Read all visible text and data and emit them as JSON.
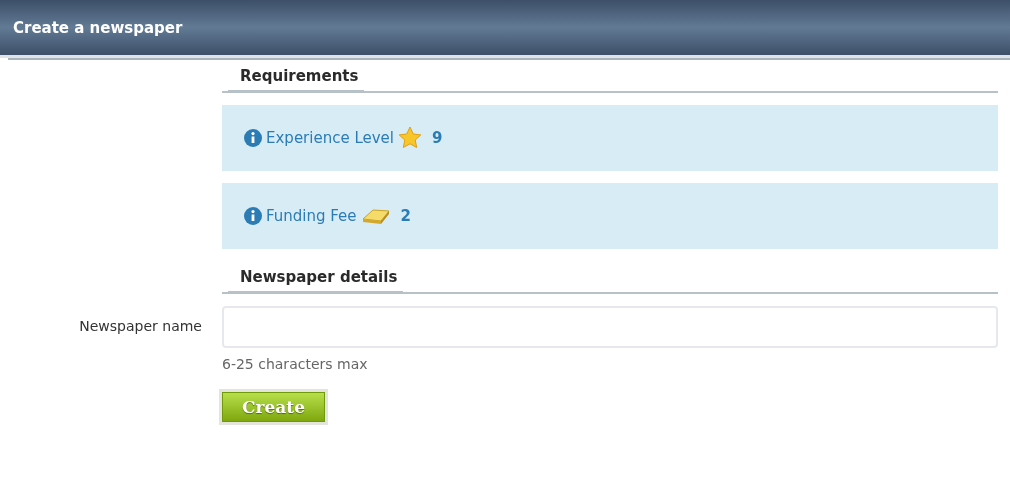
{
  "window": {
    "title": "Create a newspaper"
  },
  "requirements": {
    "heading": "Requirements",
    "items": [
      {
        "label": "Experience Level",
        "kind": "star",
        "value": "9"
      },
      {
        "label": "Funding Fee",
        "kind": "gold",
        "value": "2"
      }
    ]
  },
  "details": {
    "heading": "Newspaper details",
    "field_label": "Newspaper name",
    "hint": "6-25 characters max"
  },
  "buttons": [
    "Create"
  ]
}
